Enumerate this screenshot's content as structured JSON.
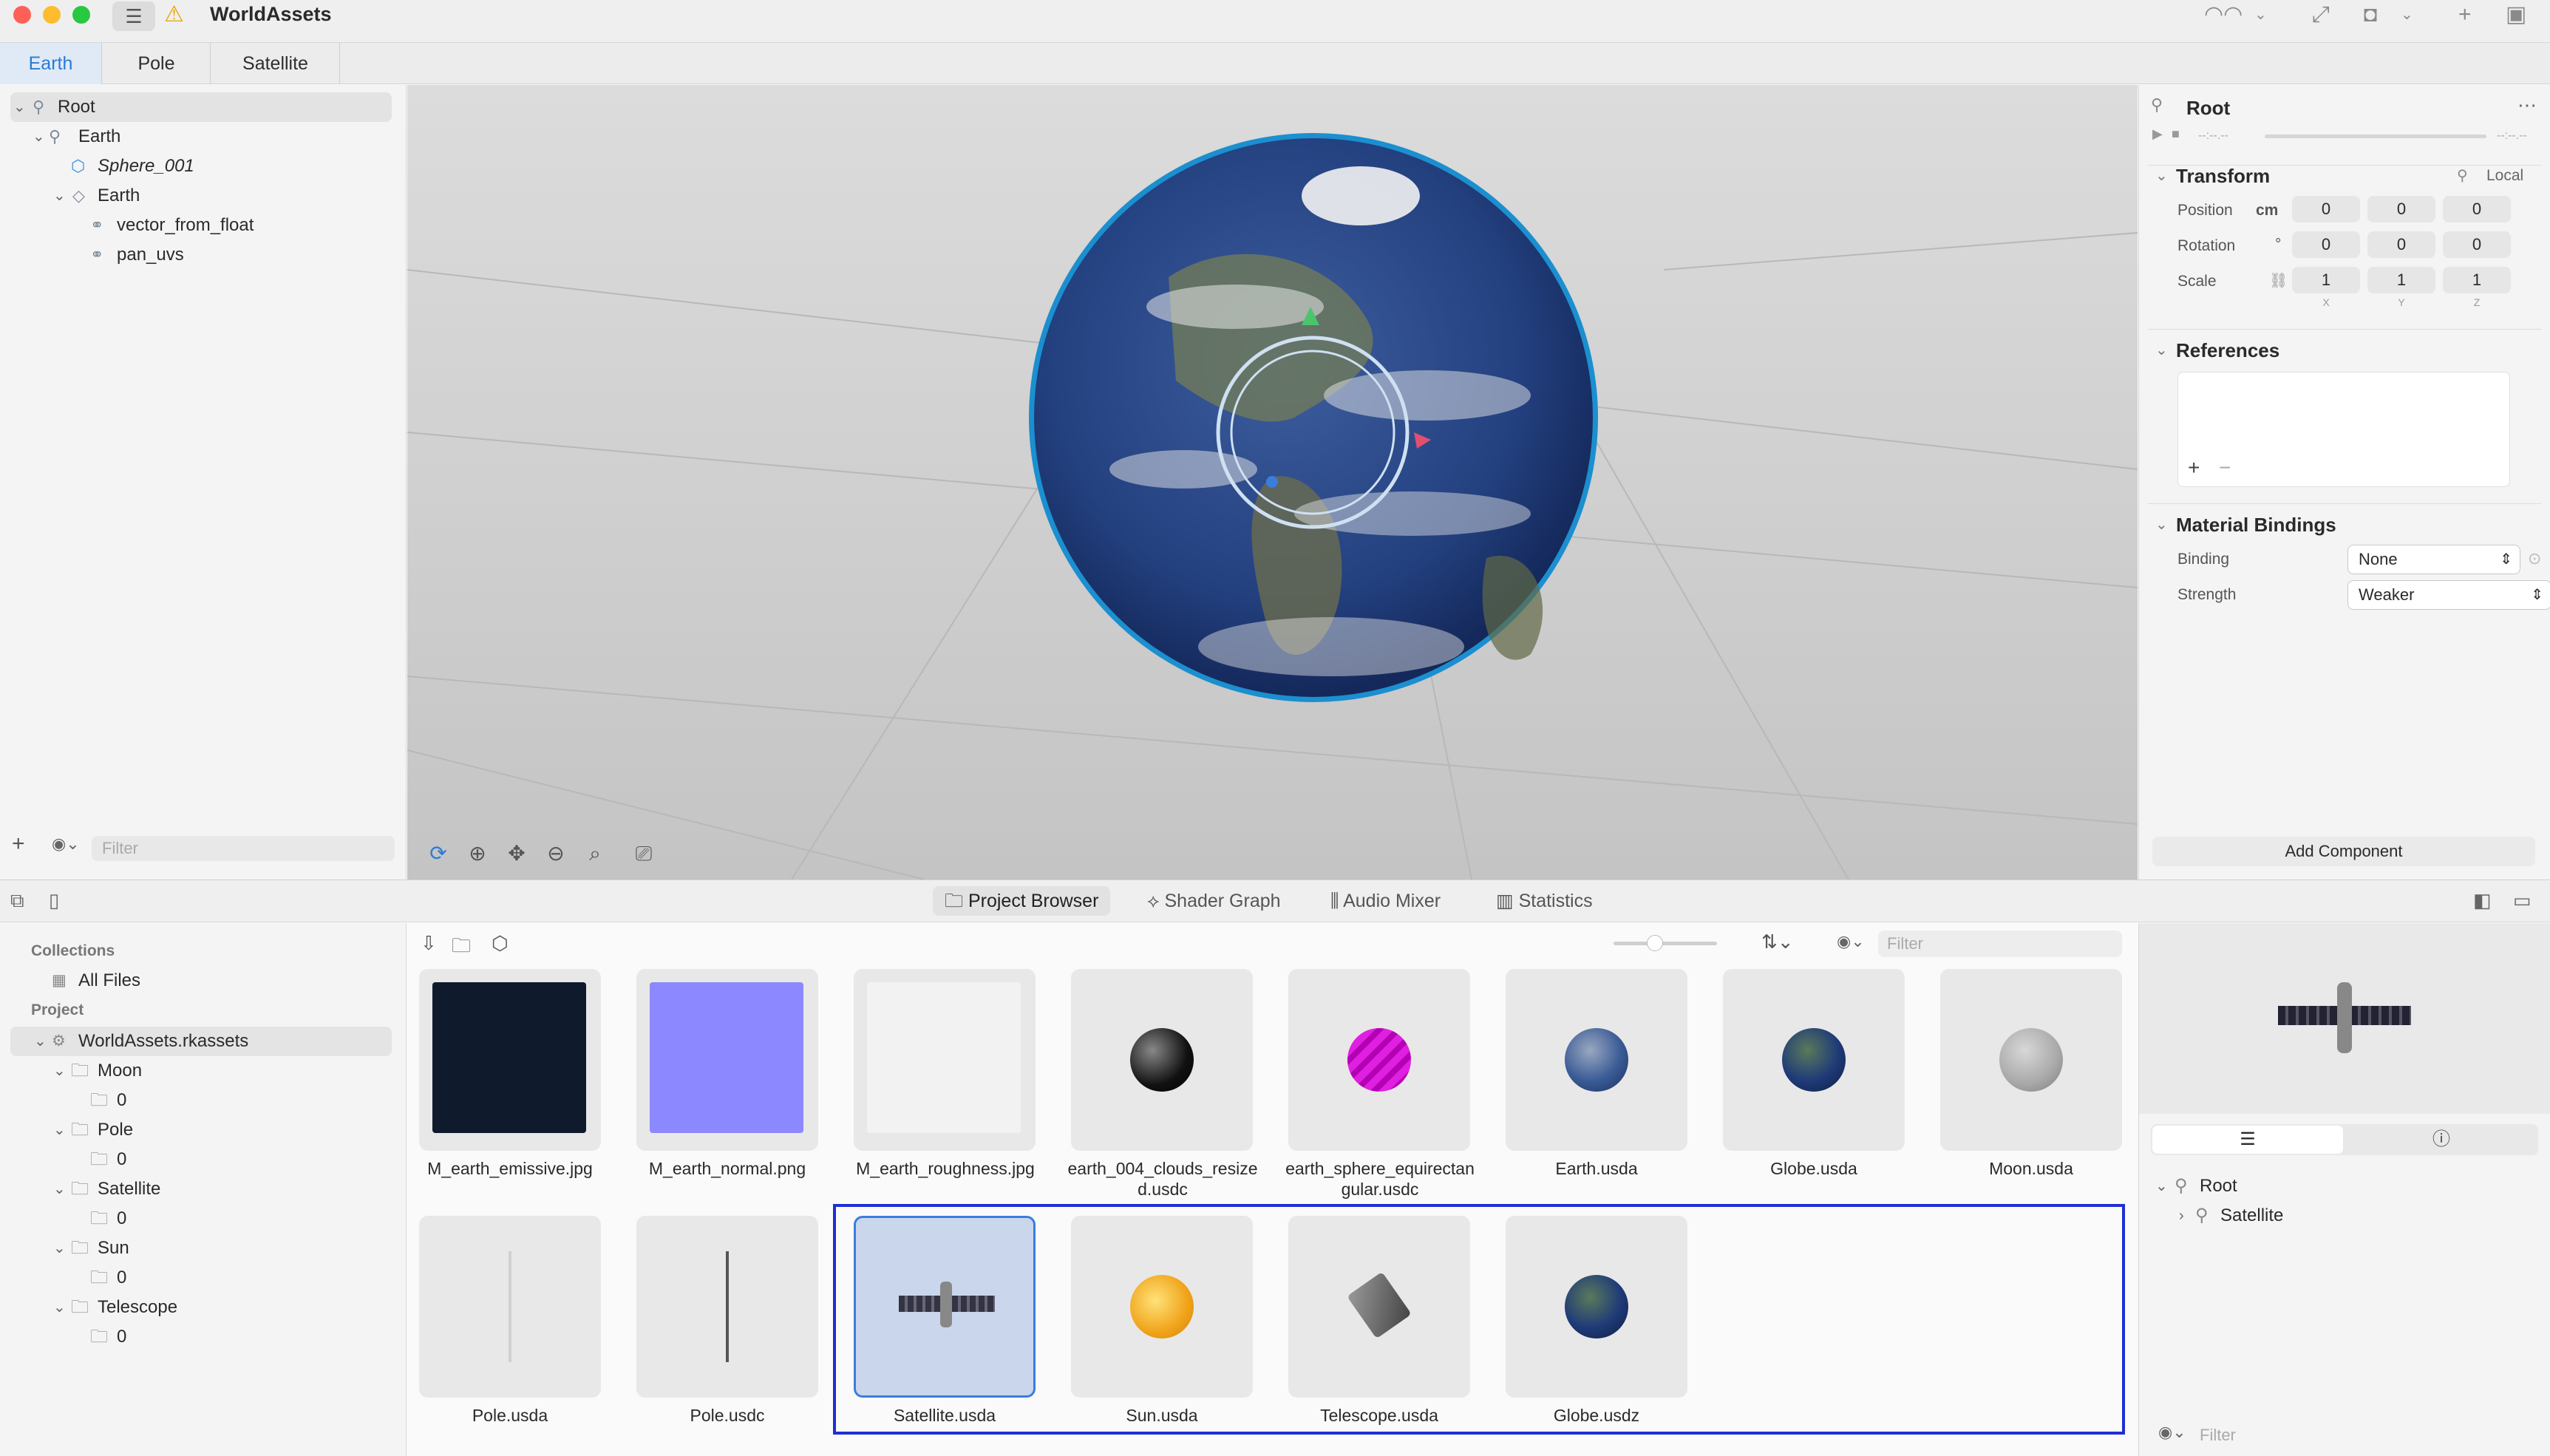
{
  "window": {
    "title": "WorldAssets"
  },
  "scene_tabs": [
    {
      "label": "Earth",
      "active": true
    },
    {
      "label": "Pole",
      "active": false
    },
    {
      "label": "Satellite",
      "active": false
    }
  ],
  "outliner": {
    "items": [
      {
        "label": "Root"
      },
      {
        "label": "Earth"
      },
      {
        "label": "Sphere_001"
      },
      {
        "label": "Earth"
      },
      {
        "label": "vector_from_float"
      },
      {
        "label": "pan_uvs"
      }
    ],
    "filter_placeholder": "Filter"
  },
  "inspector": {
    "title": "Root",
    "timeline_start": "--:--.--",
    "timeline_end": "--:--.--",
    "transform": {
      "label": "Transform",
      "space": "Local",
      "unit": "cm",
      "degree": "°",
      "position_label": "Position",
      "position": [
        "0",
        "0",
        "0"
      ],
      "rotation_label": "Rotation",
      "rotation": [
        "0",
        "0",
        "0"
      ],
      "scale_label": "Scale",
      "scale": [
        "1",
        "1",
        "1"
      ],
      "axes": [
        "X",
        "Y",
        "Z"
      ]
    },
    "references": {
      "label": "References"
    },
    "material_bindings": {
      "label": "Material Bindings",
      "binding_label": "Binding",
      "binding_value": "None",
      "strength_label": "Strength",
      "strength_value": "Weaker"
    },
    "add_component": "Add Component"
  },
  "bottom_tabs": [
    {
      "label": "Project Browser",
      "active": true
    },
    {
      "label": "Shader Graph",
      "active": false
    },
    {
      "label": "Audio Mixer",
      "active": false
    },
    {
      "label": "Statistics",
      "active": false
    }
  ],
  "collections": {
    "collections_header": "Collections",
    "all_files": "All Files",
    "project_header": "Project",
    "project_name": "WorldAssets.rkassets",
    "folders": [
      {
        "label": "Moon",
        "child": "0"
      },
      {
        "label": "Pole",
        "child": "0"
      },
      {
        "label": "Satellite",
        "child": "0"
      },
      {
        "label": "Sun",
        "child": "0"
      },
      {
        "label": "Telescope",
        "child": "0"
      }
    ]
  },
  "browser": {
    "filter_placeholder": "Filter",
    "zoom": 0.4,
    "files": [
      {
        "name": "M_earth_emissive.jpg",
        "thumb": "earth-night"
      },
      {
        "name": "M_earth_normal.png",
        "thumb": "normal-map"
      },
      {
        "name": "M_earth_roughness.jpg",
        "thumb": "roughness-map"
      },
      {
        "name": "earth_004_clouds_resized.usdc",
        "thumb": "black-sphere"
      },
      {
        "name": "earth_sphere_equirectangular.usdc",
        "thumb": "magenta-sphere"
      },
      {
        "name": "Earth.usda",
        "thumb": "earth-sphere"
      },
      {
        "name": "Globe.usda",
        "thumb": "globe-sphere"
      },
      {
        "name": "Moon.usda",
        "thumb": "moon-sphere"
      },
      {
        "name": "Pole.usda",
        "thumb": "pole-light"
      },
      {
        "name": "Pole.usdc",
        "thumb": "pole-dark"
      },
      {
        "name": "Satellite.usda",
        "thumb": "satellite",
        "selected": true
      },
      {
        "name": "Sun.usda",
        "thumb": "sun-sphere"
      },
      {
        "name": "Telescope.usda",
        "thumb": "telescope"
      },
      {
        "name": "Globe.usdz",
        "thumb": "globe-sphere"
      }
    ]
  },
  "preview_panel": {
    "tree": [
      {
        "label": "Root"
      },
      {
        "label": "Satellite"
      }
    ],
    "filter_placeholder": "Filter"
  }
}
